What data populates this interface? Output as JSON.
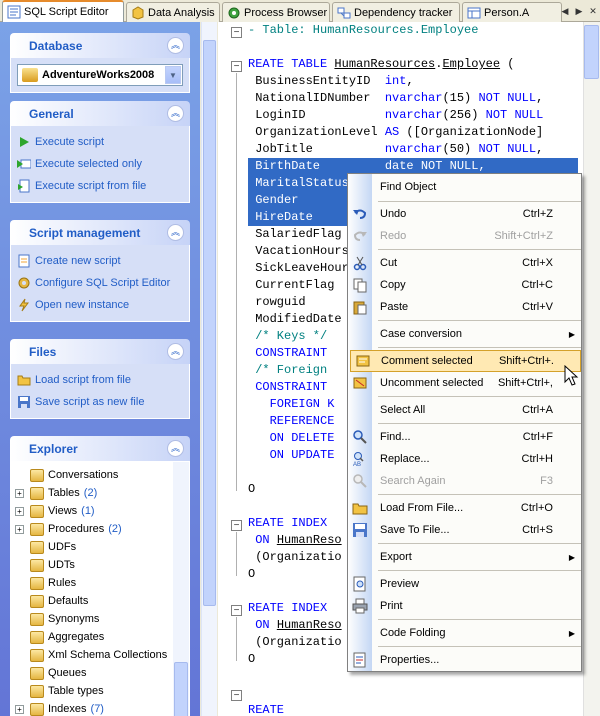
{
  "tabs": [
    {
      "label": "SQL Script Editor",
      "icon": "sql-editor-icon",
      "active": true
    },
    {
      "label": "Data Analysis",
      "icon": "data-analysis-icon",
      "active": false
    },
    {
      "label": "Process Browser",
      "icon": "process-browser-icon",
      "active": false
    },
    {
      "label": "Dependency tracker",
      "icon": "dependency-icon",
      "active": false
    },
    {
      "label": "Person.A",
      "icon": "table-icon",
      "active": false
    }
  ],
  "left": {
    "database": {
      "title": "Database",
      "selected": "AdventureWorks2008"
    },
    "general": {
      "title": "General",
      "items": [
        "Execute script",
        "Execute selected only",
        "Execute script from file"
      ]
    },
    "script_management": {
      "title": "Script management",
      "items": [
        "Create new script",
        "Configure SQL Script Editor",
        "Open new instance"
      ]
    },
    "files": {
      "title": "Files",
      "items": [
        "Load script from file",
        "Save script as new file"
      ]
    },
    "explorer": {
      "title": "Explorer",
      "items": [
        {
          "label": "Conversations",
          "count": "",
          "expandable": false
        },
        {
          "label": "Tables",
          "count": "(2)",
          "expandable": true
        },
        {
          "label": "Views",
          "count": "(1)",
          "expandable": true
        },
        {
          "label": "Procedures",
          "count": "(2)",
          "expandable": true
        },
        {
          "label": "UDFs",
          "count": "",
          "expandable": false
        },
        {
          "label": "UDTs",
          "count": "",
          "expandable": false
        },
        {
          "label": "Rules",
          "count": "",
          "expandable": false
        },
        {
          "label": "Defaults",
          "count": "",
          "expandable": false
        },
        {
          "label": "Synonyms",
          "count": "",
          "expandable": false
        },
        {
          "label": "Aggregates",
          "count": "",
          "expandable": false
        },
        {
          "label": "Xml Schema Collections",
          "count": "",
          "expandable": false
        },
        {
          "label": "Queues",
          "count": "",
          "expandable": false
        },
        {
          "label": "Table types",
          "count": "",
          "expandable": false
        },
        {
          "label": "Indexes",
          "count": "(7)",
          "expandable": true
        }
      ]
    }
  },
  "code": {
    "lines": [
      "- Table: HumanResources.Employee",
      "",
      "REATE TABLE HumanResources.Employee (",
      " BusinessEntityID  int,",
      " NationalIDNumber  nvarchar(15) NOT NULL,",
      " LoginID           nvarchar(256) NOT NULL",
      " OrganizationLevel AS ([OrganizationNode]",
      " JobTitle          nvarchar(50) NOT NULL,",
      " BirthDate         date NOT NULL,",
      " MaritalStatus",
      " Gender",
      " HireDate",
      " SalariedFlag",
      " VacationHours",
      " SickLeaveHours",
      " CurrentFlag",
      " rowguid",
      " ModifiedDate",
      " /* Keys */",
      " CONSTRAINT",
      " /* Foreign",
      " CONSTRAINT",
      "   FOREIGN K",
      "   REFERENCE",
      "   ON DELETE",
      "   ON UPDATE",
      "",
      "O",
      "",
      "REATE INDEX",
      " ON HumanReso",
      " (Organizatio",
      "O",
      "",
      "REATE INDEX",
      " ON HumanReso",
      " (Organizatio",
      "O",
      "",
      "",
      "REATE"
    ]
  },
  "context_menu": {
    "items": [
      {
        "label": "Find Object",
        "shortcut": "",
        "icon": "find-object-icon",
        "disabled": false,
        "submenu": false
      },
      {
        "label": "Undo",
        "shortcut": "Ctrl+Z",
        "icon": "undo-icon",
        "disabled": false,
        "submenu": false
      },
      {
        "label": "Redo",
        "shortcut": "Shift+Ctrl+Z",
        "icon": "redo-icon",
        "disabled": true,
        "submenu": false
      },
      {
        "label": "Cut",
        "shortcut": "Ctrl+X",
        "icon": "cut-icon",
        "disabled": false,
        "submenu": false
      },
      {
        "label": "Copy",
        "shortcut": "Ctrl+C",
        "icon": "copy-icon",
        "disabled": false,
        "submenu": false
      },
      {
        "label": "Paste",
        "shortcut": "Ctrl+V",
        "icon": "paste-icon",
        "disabled": false,
        "submenu": false
      },
      {
        "label": "Case conversion",
        "shortcut": "",
        "icon": "",
        "disabled": false,
        "submenu": true
      },
      {
        "label": "Comment selected",
        "shortcut": "Shift+Ctrl+.",
        "icon": "comment-icon",
        "disabled": false,
        "submenu": false,
        "hover": true
      },
      {
        "label": "Uncomment selected",
        "shortcut": "Shift+Ctrl+,",
        "icon": "uncomment-icon",
        "disabled": false,
        "submenu": false
      },
      {
        "label": "Select All",
        "shortcut": "Ctrl+A",
        "icon": "",
        "disabled": false,
        "submenu": false
      },
      {
        "label": "Find...",
        "shortcut": "Ctrl+F",
        "icon": "find-icon",
        "disabled": false,
        "submenu": false
      },
      {
        "label": "Replace...",
        "shortcut": "Ctrl+H",
        "icon": "replace-icon",
        "disabled": false,
        "submenu": false
      },
      {
        "label": "Search Again",
        "shortcut": "F3",
        "icon": "search-again-icon",
        "disabled": true,
        "submenu": false
      },
      {
        "label": "Load From File...",
        "shortcut": "Ctrl+O",
        "icon": "open-file-icon",
        "disabled": false,
        "submenu": false
      },
      {
        "label": "Save To File...",
        "shortcut": "Ctrl+S",
        "icon": "save-file-icon",
        "disabled": false,
        "submenu": false
      },
      {
        "label": "Export",
        "shortcut": "",
        "icon": "",
        "disabled": false,
        "submenu": true
      },
      {
        "label": "Preview",
        "shortcut": "",
        "icon": "preview-icon",
        "disabled": false,
        "submenu": false
      },
      {
        "label": "Print",
        "shortcut": "",
        "icon": "print-icon",
        "disabled": false,
        "submenu": false
      },
      {
        "label": "Code Folding",
        "shortcut": "",
        "icon": "",
        "disabled": false,
        "submenu": true
      },
      {
        "label": "Properties...",
        "shortcut": "",
        "icon": "properties-icon",
        "disabled": false,
        "submenu": false
      }
    ]
  }
}
